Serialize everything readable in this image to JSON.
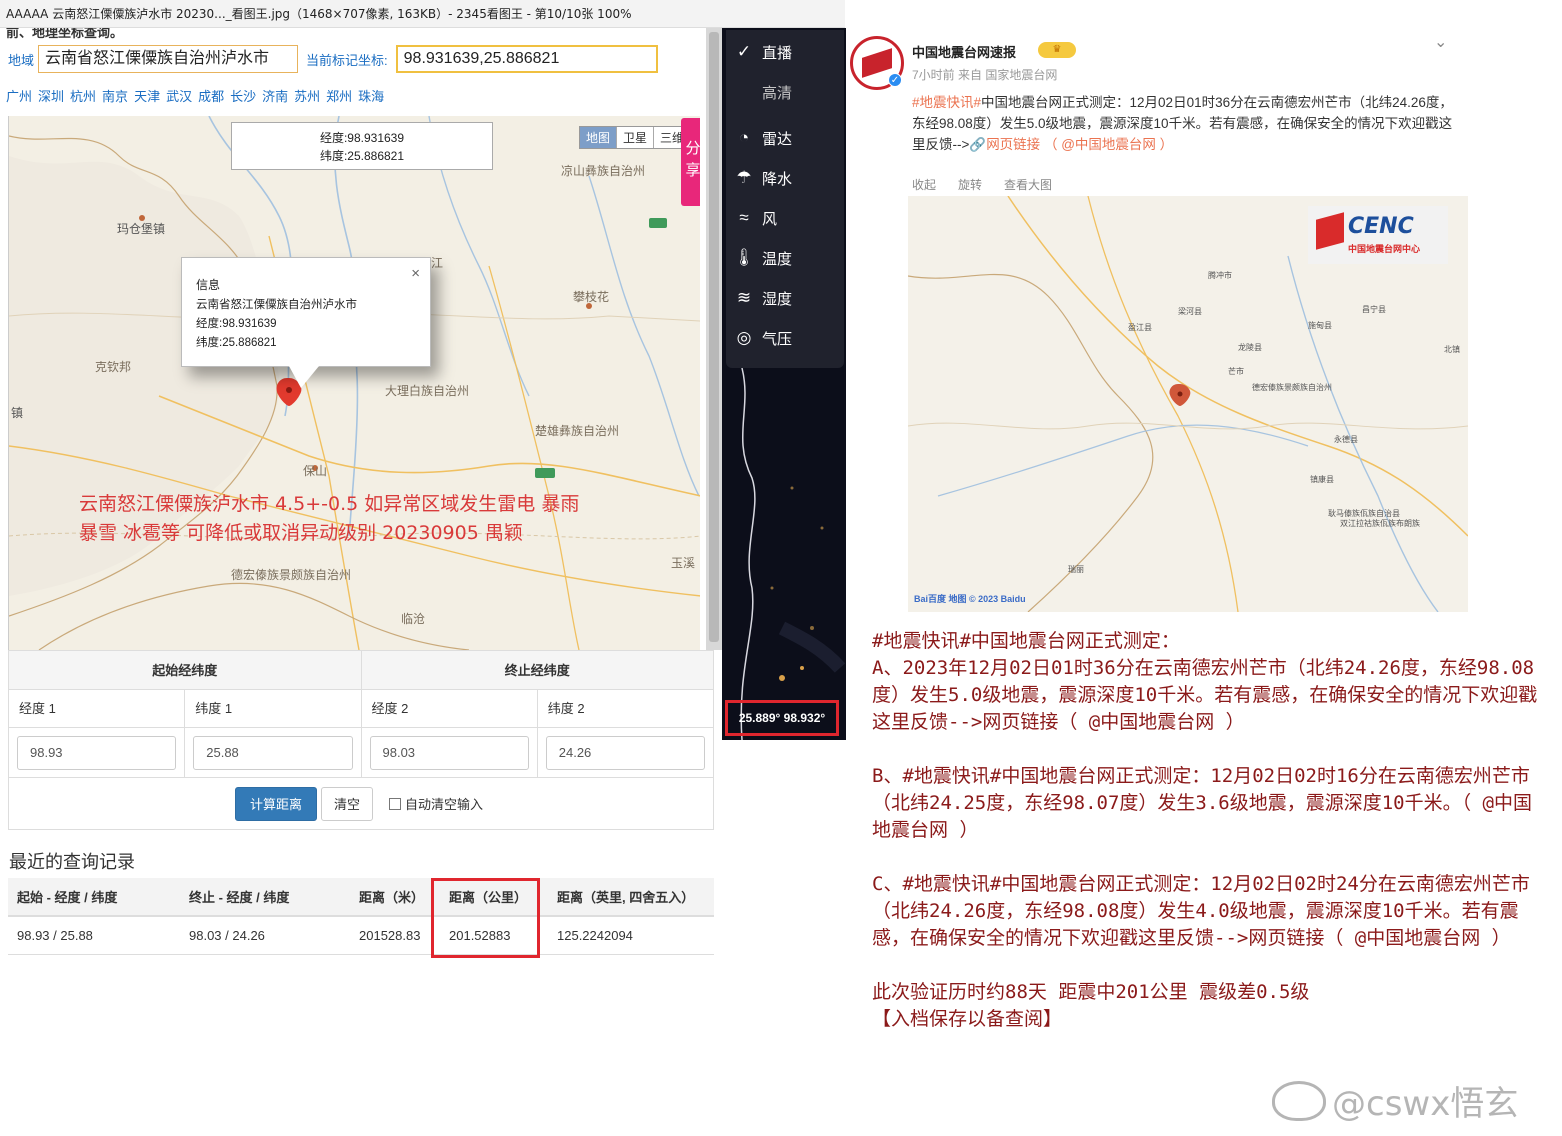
{
  "viewer": {
    "title": "AAAAA 云南怒江傈僳族泸水市 20230..._看图王.jpg（1468×707像素, 163KB）- 2345看图王 - 第10/10张 100%"
  },
  "locator": {
    "header_fragment": "前、地理坐标查询。",
    "region_label": "地域",
    "region_value": "云南省怒江傈僳族自治州泸水市",
    "coord_label": "当前标记坐标:",
    "coord_value": "98.931639,25.886821",
    "cities": [
      "广州",
      "深圳",
      "杭州",
      "南京",
      "天津",
      "武汉",
      "成都",
      "长沙",
      "济南",
      "苏州",
      "郑州",
      "珠海"
    ]
  },
  "map": {
    "tabs": [
      "地图",
      "卫星",
      "三维"
    ],
    "share": "分享",
    "tooltip_lng": "经度:98.931639",
    "tooltip_lat": "纬度:25.886821",
    "popup_title": "信息",
    "popup_address": "云南省怒江傈僳族自治州泸水市",
    "popup_lng": "经度:98.931639",
    "popup_lat": "纬度:25.886821",
    "popup_close": "×",
    "labels": {
      "liangshan": "凉山彝族自治州",
      "magu": "玛仓堡镇",
      "panzhihua": "攀枝花",
      "kechinbang": "克钦邦",
      "dali": "大理白族自治州",
      "chuxiong": "楚雄彝族自治州",
      "baoshan": "保山",
      "dehong": "德宏傣族景颇族自治州",
      "yuxi": "玉溪",
      "lincang": "临沧",
      "zhen": "镇",
      "jiang": "江"
    },
    "note_line1": "云南怒江傈僳族泸水市 4.5+-0.5 如异常区域发生雷电 暴雨",
    "note_line2": "暴雪 冰雹等 可降低或取消异动级别  20230905  禺颖"
  },
  "calculator": {
    "start_header": "起始经纬度",
    "end_header": "终止经纬度",
    "fields": [
      "经度 1",
      "纬度 1",
      "经度 2",
      "纬度 2"
    ],
    "values": [
      "98.93",
      "25.88",
      "98.03",
      "24.26"
    ],
    "calc_button": "计算距离",
    "clear_button": "清空",
    "auto_clear": "自动清空输入"
  },
  "recent": {
    "title": "最近的查询记录",
    "columns": [
      "起始 - 经度 / 纬度",
      "终止 - 经度 / 纬度",
      "距离（米）",
      "距离（公里）",
      "距离（英里, 四舍五入）"
    ],
    "row": [
      "98.93 / 25.88",
      "98.03 / 24.26",
      "201528.83",
      "201.52883",
      "125.2242094"
    ]
  },
  "weather": {
    "items": [
      {
        "icon": "✓",
        "label": "直播"
      },
      {
        "icon": "",
        "label": "高清"
      },
      {
        "icon": "◔",
        "label": "雷达"
      },
      {
        "icon": "☂",
        "label": "降水"
      },
      {
        "icon": "≈",
        "label": "风"
      },
      {
        "icon": "🌡",
        "label": "温度"
      },
      {
        "icon": "≋",
        "label": "湿度"
      },
      {
        "icon": "◎",
        "label": "气压"
      }
    ],
    "coords": "25.889°  98.932°"
  },
  "post": {
    "author": "中国地震台网速报",
    "meta": "7小时前  来自 国家地震台网",
    "tag": "#地震快讯#",
    "text": "中国地震台网正式测定：12月02日01时36分在云南德宏州芒市（北纬24.26度，东经98.08度）发生5.0级地震，震源深度10千米。若有震感，在确保安全的情况下欢迎戳这里反馈-->",
    "link1": "网页链接",
    "link2": "（ @中国地震台网 ）",
    "tools": [
      "收起",
      "旋转",
      "查看大图"
    ],
    "cenc_word": "CENC",
    "cenc_sub": "中国地震台网中心",
    "map_labels": [
      "腾冲市",
      "梁河县",
      "盈江县",
      "龙陵县",
      "芒市",
      "德宏傣族景颇族自治州",
      "施甸县",
      "昌宁县",
      "永德县",
      "镇康县",
      "耿马傣族佤族自治县",
      "双江拉祜族佤族布朗族",
      "北镇",
      "瑞丽"
    ],
    "baidu": "Bai百度 地图  © 2023 Baidu"
  },
  "analysis": {
    "heading": "#地震快讯#中国地震台网正式测定：",
    "a": "A、2023年12月02日01时36分在云南德宏州芒市（北纬24.26度，东经98.08度）发生5.0级地震，震源深度10千米。若有震感，在确保安全的情况下欢迎戳这里反馈-->网页链接（ @中国地震台网 ）",
    "b": "B、#地震快讯#中国地震台网正式测定：12月02日02时16分在云南德宏州芒市（北纬24.25度，东经98.07度）发生3.6级地震，震源深度10千米。（ @中国地震台网 ）",
    "c": "C、#地震快讯#中国地震台网正式测定：12月02日02时24分在云南德宏州芒市（北纬24.26度，东经98.08度）发生4.0级地震，震源深度10千米。若有震感，在确保安全的情况下欢迎戳这里反馈-->网页链接（ @中国地震台网 ）",
    "verify": "此次验证历时约88天 距震中201公里 震级差0.5级",
    "archive": "【入档保存以备查阅】"
  },
  "watermark": "@cswx悟玄",
  "colors": {
    "accent_red": "#e0262e",
    "link_blue": "#1a6dc2",
    "note_red": "#d93a3a",
    "analysis_text": "#8b1a1a",
    "button_blue": "#337ab7"
  }
}
